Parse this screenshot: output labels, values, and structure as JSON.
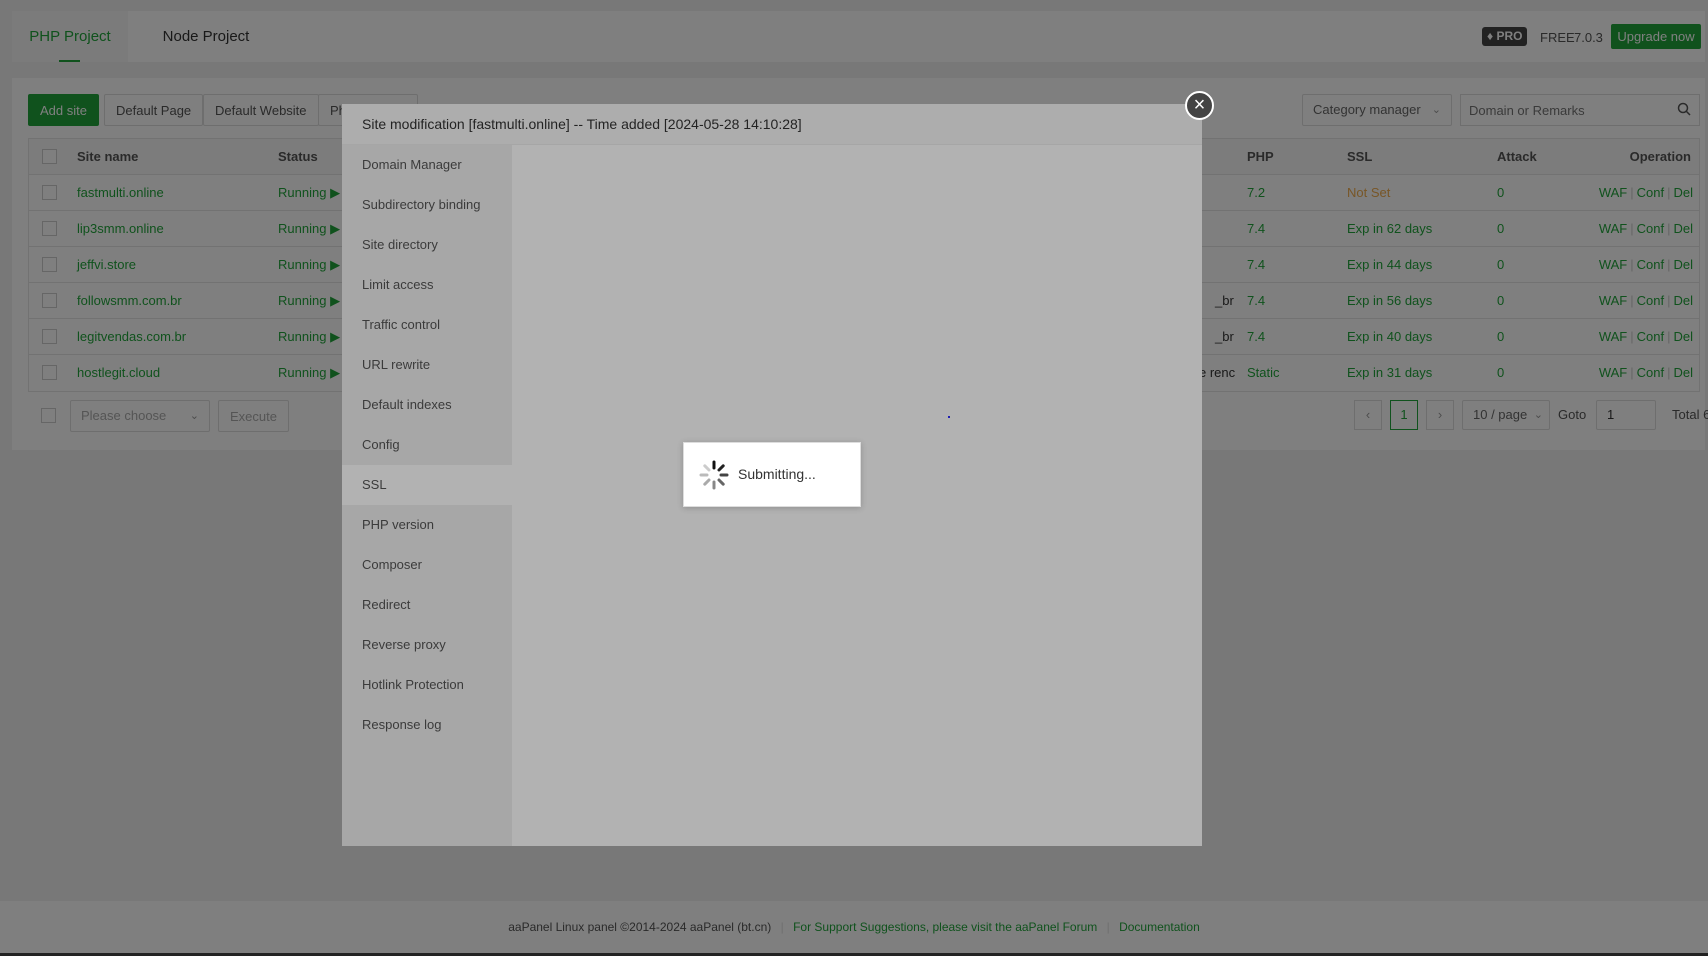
{
  "topbar": {
    "tabs": [
      "PHP Project",
      "Node Project"
    ],
    "pro_badge": "PRO",
    "free_label": "FREE",
    "version": "7.0.3",
    "upgrade_label": "Upgrade now"
  },
  "toolbar": {
    "add_site": "Add site",
    "default_page": "Default Page",
    "default_website": "Default Website",
    "partial_button": "Ph",
    "category_manager": "Category manager",
    "search_placeholder": "Domain or Remarks"
  },
  "table": {
    "headers": {
      "site_name": "Site name",
      "status": "Status",
      "php": "PHP",
      "ssl": "SSL",
      "attack": "Attack",
      "operation": "Operation"
    },
    "rows": [
      {
        "name": "fastmulti.online",
        "status": "Running",
        "extra": "",
        "php": "7.2",
        "ssl": "Not Set",
        "attack": "0"
      },
      {
        "name": "lip3smm.online",
        "status": "Running",
        "extra": "",
        "php": "7.4",
        "ssl": "Exp in 62 days",
        "attack": "0"
      },
      {
        "name": "jeffvi.store",
        "status": "Running",
        "extra": "",
        "php": "7.4",
        "ssl": "Exp in 44 days",
        "attack": "0"
      },
      {
        "name": "followsmm.com.br",
        "status": "Running",
        "extra": "_br",
        "php": "7.4",
        "ssl": "Exp in 56 days",
        "attack": "0"
      },
      {
        "name": "legitvendas.com.br",
        "status": "Running",
        "extra": "_br",
        "php": "7.4",
        "ssl": "Exp in 40 days",
        "attack": "0"
      },
      {
        "name": "hostlegit.cloud",
        "status": "Running",
        "extra": "e renc",
        "php": "Static",
        "ssl": "Exp in 31 days",
        "attack": "0"
      }
    ],
    "ops": [
      "WAF",
      "Conf",
      "Del"
    ]
  },
  "bulk": {
    "select_placeholder": "Please choose",
    "execute": "Execute"
  },
  "pagination": {
    "current_page": "1",
    "per_page": "10 / page",
    "goto_label": "Goto",
    "goto_value": "1",
    "total": "Total 6"
  },
  "modal": {
    "title": "Site modification [fastmulti.online] -- Time added [2024-05-28 14:10:28]",
    "close": "×",
    "menu": [
      "Domain Manager",
      "Subdirectory binding",
      "Site directory",
      "Limit access",
      "Traffic control",
      "URL rewrite",
      "Default indexes",
      "Config",
      "SSL",
      "PHP version",
      "Composer",
      "Redirect",
      "Reverse proxy",
      "Hotlink Protection",
      "Response log"
    ],
    "active_item": "SSL"
  },
  "loading": {
    "text": "Submitting..."
  },
  "footer": {
    "copyright": "aaPanel Linux panel ©2014-2024 aaPanel (bt.cn)",
    "support": "For Support Suggestions, please visit the aaPanel Forum",
    "docs": "Documentation"
  },
  "colors": {
    "accent": "#20a53a",
    "warning": "#f0ad4e"
  }
}
